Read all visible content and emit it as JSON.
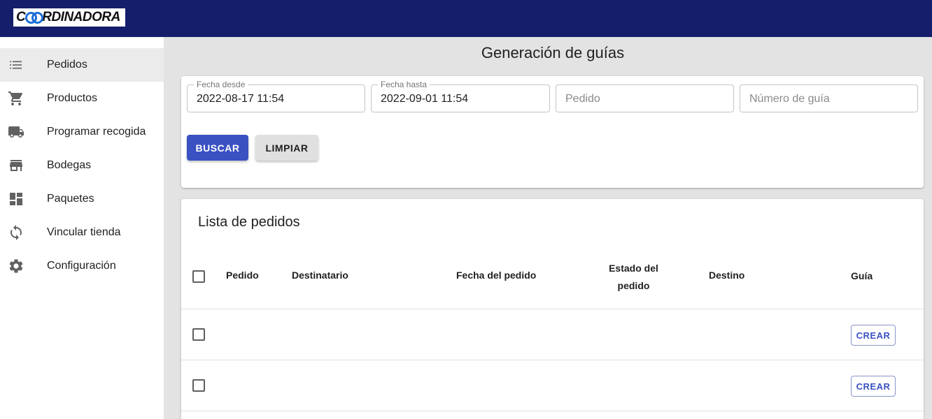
{
  "header": {
    "logo_text": "COORDINADORA"
  },
  "sidebar": {
    "items": [
      {
        "label": "Pedidos",
        "icon": "list-icon",
        "active": true
      },
      {
        "label": "Productos",
        "icon": "cart-icon",
        "active": false
      },
      {
        "label": "Programar recogida",
        "icon": "truck-icon",
        "active": false
      },
      {
        "label": "Bodegas",
        "icon": "store-icon",
        "active": false
      },
      {
        "label": "Paquetes",
        "icon": "dashboard-icon",
        "active": false
      },
      {
        "label": "Vincular tienda",
        "icon": "sync-icon",
        "active": false
      },
      {
        "label": "Configuración",
        "icon": "gear-icon",
        "active": false
      }
    ]
  },
  "page": {
    "title": "Generación de guías"
  },
  "filters": {
    "fecha_desde": {
      "label": "Fecha desde",
      "value": "2022-08-17 11:54"
    },
    "fecha_hasta": {
      "label": "Fecha hasta",
      "value": "2022-09-01 11:54"
    },
    "pedido": {
      "placeholder": "Pedido"
    },
    "numero_guia": {
      "placeholder": "Número de guía"
    },
    "search_label": "BUSCAR",
    "clear_label": "LIMPIAR"
  },
  "orders": {
    "title": "Lista de pedidos",
    "columns": [
      "Pedido",
      "Destinatario",
      "Fecha del pedido",
      "Estado del pedido",
      "Destino",
      "Guía"
    ],
    "rows": [
      {
        "action_label": "CREAR"
      },
      {
        "action_label": "CREAR"
      }
    ]
  },
  "colors": {
    "header_bg": "#141e6b",
    "primary": "#3a51c2",
    "logo_accent": "#1d6fd8"
  }
}
